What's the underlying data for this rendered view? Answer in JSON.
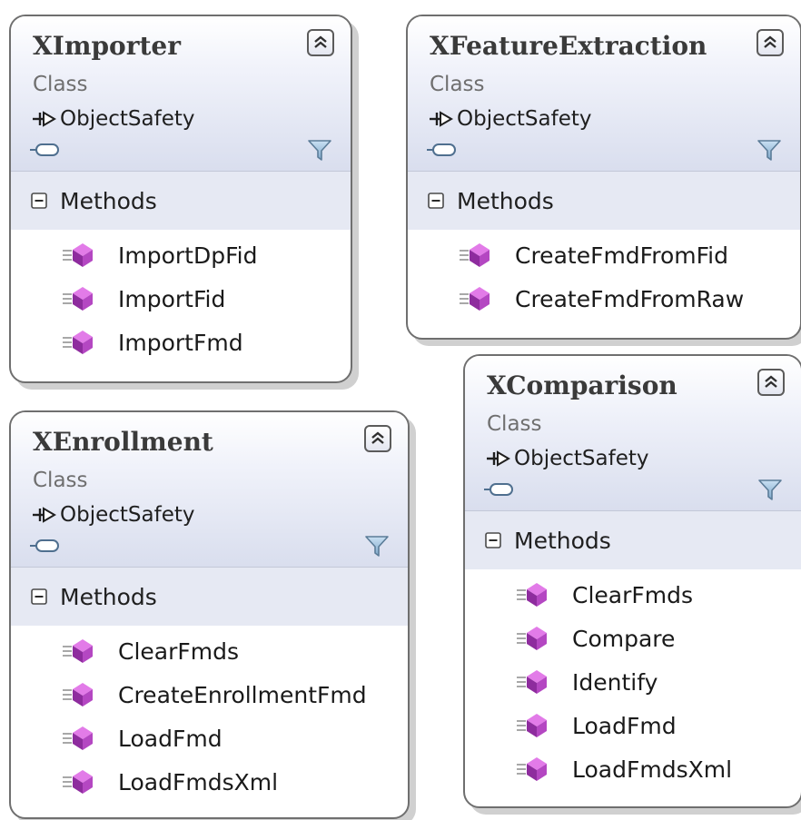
{
  "classes": [
    {
      "name": "XImporter",
      "stereotype": "Class",
      "base": "ObjectSafety",
      "section": "Methods",
      "methods": [
        "ImportDpFid",
        "ImportFid",
        "ImportFmd"
      ]
    },
    {
      "name": "XFeatureExtraction",
      "stereotype": "Class",
      "base": "ObjectSafety",
      "section": "Methods",
      "methods": [
        "CreateFmdFromFid",
        "CreateFmdFromRaw"
      ]
    },
    {
      "name": "XEnrollment",
      "stereotype": "Class",
      "base": "ObjectSafety",
      "section": "Methods",
      "methods": [
        "ClearFmds",
        "CreateEnrollmentFmd",
        "LoadFmd",
        "LoadFmdsXml"
      ]
    },
    {
      "name": "XComparison",
      "stereotype": "Class",
      "base": "ObjectSafety",
      "section": "Methods",
      "methods": [
        "ClearFmds",
        "Compare",
        "Identify",
        "LoadFmd",
        "LoadFmdsXml"
      ]
    }
  ],
  "icons": {
    "collapse": "double-chevron-up-icon",
    "filter": "funnel-icon",
    "inheritance": "inheritance-arrow-icon",
    "interface": "interface-lollipop-icon",
    "section_toggle": "minus-box-icon",
    "method": "public-method-icon"
  },
  "colors": {
    "header_gradient_bottom": "#d9deee",
    "section_bar": "#e6e9f3",
    "border": "#6f6f6f",
    "method_icon": "#b03fbf"
  }
}
